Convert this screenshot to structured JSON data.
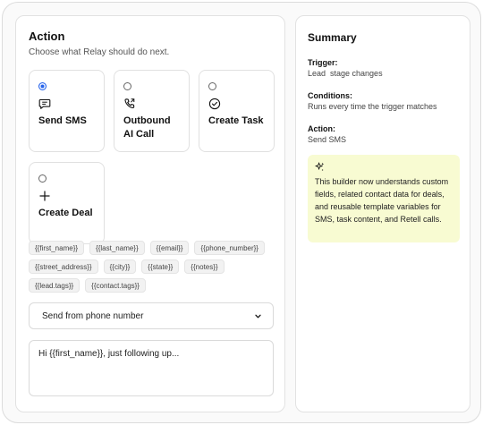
{
  "action": {
    "title": "Action",
    "subtitle": "Choose what Relay should do next.",
    "options": [
      {
        "label": "Send SMS",
        "icon": "message-icon",
        "selected": true
      },
      {
        "label": "Outbound\nAI Call",
        "icon": "phone-call-icon",
        "selected": false
      },
      {
        "label": "Create Task",
        "icon": "check-circle-icon",
        "selected": false
      },
      {
        "label": "Create Deal",
        "icon": "plus-icon",
        "selected": false
      }
    ],
    "variables": [
      [
        "{{first_name}}",
        "{{last_name}}",
        "{{email}}",
        "{{phone_number}}"
      ],
      [
        "{{street_address}}",
        "{{city}}",
        "{{state}}",
        "{{notes}}"
      ],
      [
        "{{lead.tags}}",
        "{{contact.tags}}"
      ]
    ],
    "phone_select": {
      "value": "Send from phone number"
    },
    "message": {
      "value": "Hi {{first_name}}, just following up..."
    }
  },
  "summary": {
    "title": "Summary",
    "trigger_label": "Trigger:",
    "trigger_value": "Lead  stage changes",
    "conditions_label": "Conditions:",
    "conditions_value": "Runs every time the trigger matches",
    "action_label": "Action:",
    "action_value": "Send SMS",
    "note": "This builder now understands custom fields, related contact data for deals, and reusable template variables for SMS, task content, and Retell calls."
  },
  "colors": {
    "accent": "#2563eb",
    "note_background": "#f8fbd2"
  }
}
